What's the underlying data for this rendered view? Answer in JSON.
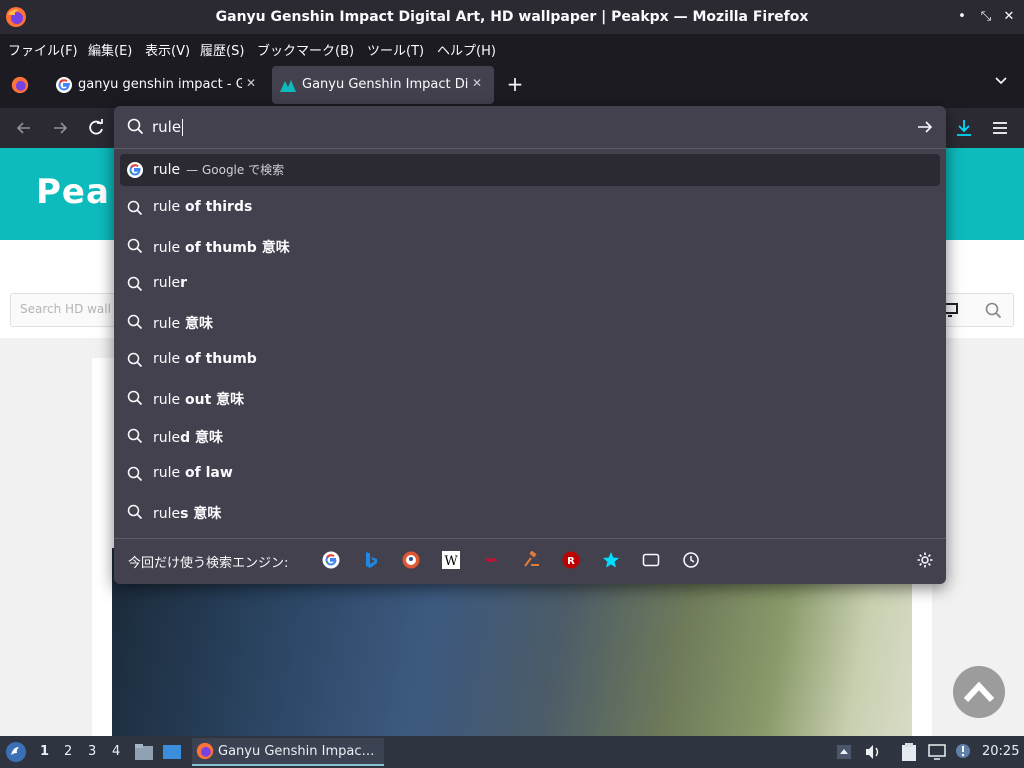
{
  "window": {
    "title": "Ganyu Genshin Impact Digital Art, HD wallpaper | Peakpx — Mozilla Firefox"
  },
  "menu": {
    "items": [
      "ファイル(F)",
      "編集(E)",
      "表示(V)",
      "履歴(S)",
      "ブックマーク(B)",
      "ツール(T)",
      "ヘルプ(H)"
    ]
  },
  "tabs": [
    {
      "label": "ganyu genshin impact - Goo",
      "active": false
    },
    {
      "label": "Ganyu Genshin Impact Digi",
      "active": true
    }
  ],
  "urlbar": {
    "query": "rule"
  },
  "suggestions": [
    {
      "prefix": "rule",
      "bold": "",
      "note": "— Google で検索",
      "icon": "google-icon",
      "selected": true
    },
    {
      "prefix": "rule",
      "bold": " of thirds",
      "note": "",
      "icon": "search-icon",
      "selected": false
    },
    {
      "prefix": "rule",
      "bold": " of thumb 意味",
      "note": "",
      "icon": "search-icon",
      "selected": false
    },
    {
      "prefix": "rule",
      "bold": "r",
      "note": "",
      "icon": "search-icon",
      "selected": false
    },
    {
      "prefix": "rule",
      "bold": " 意味",
      "note": "",
      "icon": "search-icon",
      "selected": false
    },
    {
      "prefix": "rule",
      "bold": " of thumb",
      "note": "",
      "icon": "search-icon",
      "selected": false
    },
    {
      "prefix": "rule",
      "bold": " out 意味",
      "note": "",
      "icon": "search-icon",
      "selected": false
    },
    {
      "prefix": "rule",
      "bold": "d 意味",
      "note": "",
      "icon": "search-icon",
      "selected": false
    },
    {
      "prefix": "rule",
      "bold": " of law",
      "note": "",
      "icon": "search-icon",
      "selected": false
    },
    {
      "prefix": "rule",
      "bold": "s 意味",
      "note": "",
      "icon": "search-icon",
      "selected": false
    }
  ],
  "engines": {
    "label": "今回だけ使う検索エンジン:",
    "items": [
      "google-icon",
      "bing-icon",
      "duckduckgo-icon",
      "wikipedia-icon",
      "ebay-icon",
      "amazon-auction-icon",
      "rakuten-icon",
      "bookmarks-star-icon",
      "tabs-icon",
      "history-icon"
    ]
  },
  "page": {
    "logo": "Pea",
    "search_placeholder": "Search HD wall"
  },
  "taskbar": {
    "workspaces": [
      "1",
      "2",
      "3",
      "4"
    ],
    "active_window": "Ganyu Genshin Impac…",
    "clock": "20:25"
  },
  "colors": {
    "accent_teal": "#0dbbbd",
    "download_blue": "#00ddff"
  }
}
